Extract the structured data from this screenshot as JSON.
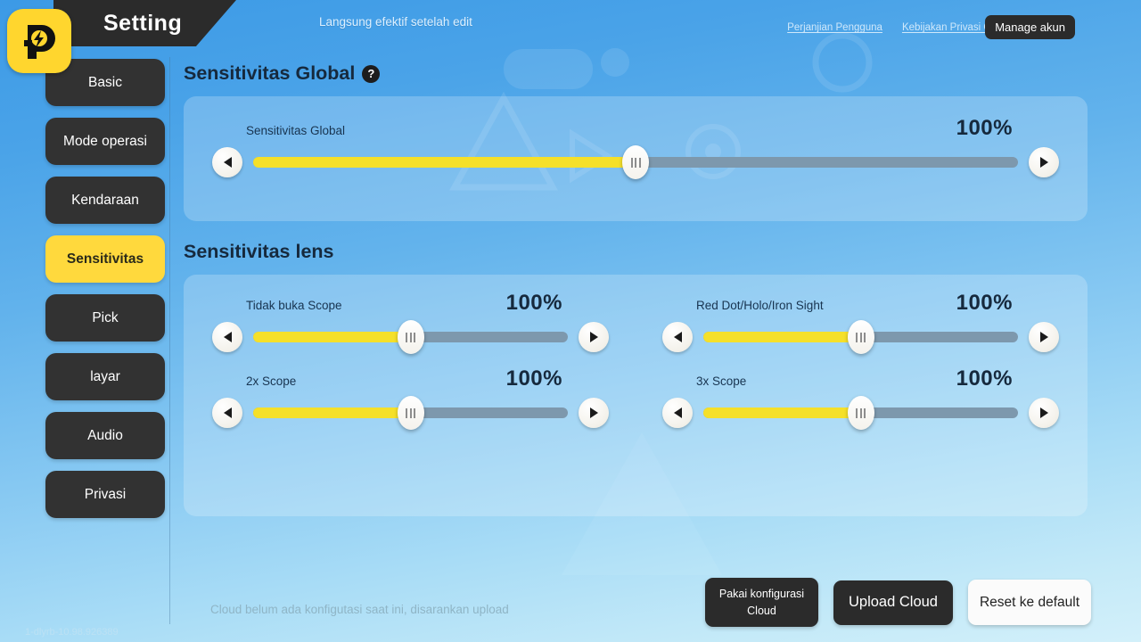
{
  "header": {
    "app_title": "Setting",
    "logo_icon": "app-logo-icon",
    "hint": "Langsung efektif setelah edit",
    "links": [
      {
        "label": "Perjanjian Pengguna"
      },
      {
        "label": "Kebijakan Privasi Online Xindong"
      }
    ],
    "manage_button": "Manage akun"
  },
  "sidebar": {
    "items": [
      {
        "label": "Basic",
        "active": false
      },
      {
        "label": "Mode operasi",
        "active": false
      },
      {
        "label": "Kendaraan",
        "active": false
      },
      {
        "label": "Sensitivitas",
        "active": true
      },
      {
        "label": "Pick",
        "active": false
      },
      {
        "label": "layar",
        "active": false
      },
      {
        "label": "Audio",
        "active": false
      },
      {
        "label": "Privasi",
        "active": false
      }
    ]
  },
  "version": "1-dlyrb-10.98.926389",
  "sections": {
    "global": {
      "title": "Sensitivitas Global",
      "help_icon": "question-mark-icon",
      "sliders": [
        {
          "label": "Sensitivitas Global",
          "value": "100%",
          "percent": 50
        }
      ]
    },
    "lens": {
      "title": "Sensitivitas lens",
      "sliders": [
        {
          "label": "Tidak buka Scope",
          "value": "100%",
          "percent": 50
        },
        {
          "label": "Red Dot/Holo/Iron Sight",
          "value": "100%",
          "percent": 50
        },
        {
          "label": "2x Scope",
          "value": "100%",
          "percent": 50
        },
        {
          "label": "3x Scope",
          "value": "100%",
          "percent": 50
        }
      ]
    }
  },
  "slider_controls": {
    "decrease_icon": "caret-left-icon",
    "increase_icon": "caret-right-icon",
    "thumb_icon": "grip-lines-icon"
  },
  "footer": {
    "cloud_note": "Cloud belum ada konfigutasi saat ini, disarankan upload",
    "use_cloud_config_line1": "Pakai konfigurasi",
    "use_cloud_config_line2": "Cloud",
    "upload_cloud": "Upload Cloud",
    "reset_default": "Reset ke default"
  },
  "colors": {
    "accent_yellow": "#ffd93d",
    "slider_fill": "#f5e02a",
    "slider_track": "#7d98ad",
    "dark_button": "#2b2b2b",
    "background_blue": "#3c9ae6"
  }
}
